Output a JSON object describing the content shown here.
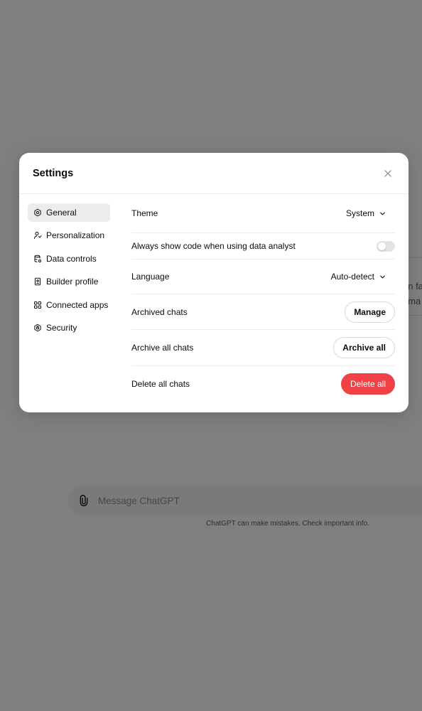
{
  "background": {
    "composer_placeholder": "Message ChatGPT",
    "disclaimer": "ChatGPT can make mistakes. Check important info.",
    "card_lines": [
      "un fa",
      "oma"
    ]
  },
  "settings": {
    "title": "Settings",
    "nav": [
      {
        "label": "General",
        "icon": "gear-icon",
        "active": true
      },
      {
        "label": "Personalization",
        "icon": "person-icon"
      },
      {
        "label": "Data controls",
        "icon": "database-icon"
      },
      {
        "label": "Builder profile",
        "icon": "id-card-icon"
      },
      {
        "label": "Connected apps",
        "icon": "grid-icon"
      },
      {
        "label": "Security",
        "icon": "shield-icon"
      }
    ],
    "rows": {
      "theme": {
        "label": "Theme",
        "value": "System"
      },
      "show_code": {
        "label": "Always show code when using data analyst",
        "enabled": false
      },
      "language": {
        "label": "Language",
        "value": "Auto-detect"
      },
      "archived": {
        "label": "Archived chats",
        "button": "Manage"
      },
      "archive_all": {
        "label": "Archive all chats",
        "button": "Archive all"
      },
      "delete_all": {
        "label": "Delete all chats",
        "button": "Delete all"
      }
    }
  },
  "colors": {
    "danger": "#ef4146",
    "overlay": "rgba(0,0,0,0.5)",
    "active_nav": "#ececec"
  }
}
